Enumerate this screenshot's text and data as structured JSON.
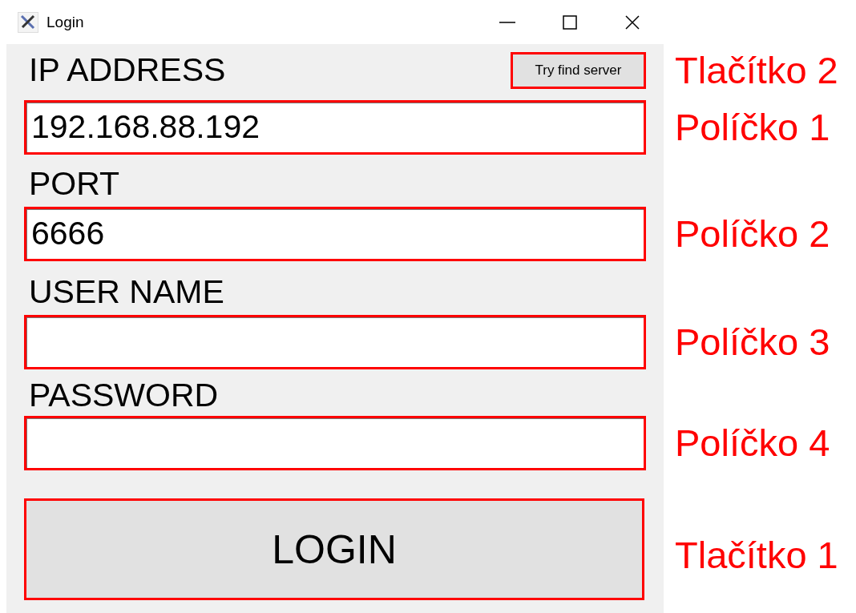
{
  "window": {
    "title": "Login"
  },
  "find_button": {
    "label": "Try find server",
    "annotation": "Tlačítko 2"
  },
  "fields": [
    {
      "label": "IP ADDRESS",
      "value": "192.168.88.192",
      "annotation": "Políčko 1"
    },
    {
      "label": "PORT",
      "value": "6666",
      "annotation": "Políčko 2"
    },
    {
      "label": "USER NAME",
      "annotation": "Políčko 3"
    },
    {
      "label": "PASSWORD",
      "annotation": "Políčko 4"
    }
  ],
  "login_button": {
    "label": "LOGIN",
    "annotation": "Tlačítko 1"
  }
}
